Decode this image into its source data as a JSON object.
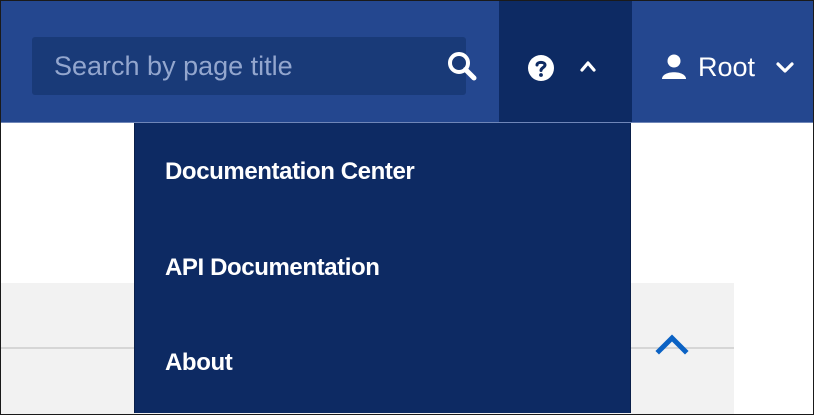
{
  "header": {
    "search": {
      "placeholder": "Search by page title"
    },
    "user": {
      "label": "Root"
    }
  },
  "help_menu": {
    "items": [
      {
        "label": "Documentation Center"
      },
      {
        "label": "API Documentation"
      },
      {
        "label": "About"
      }
    ]
  },
  "icons": {
    "search": "search-icon",
    "help": "question-circle-icon",
    "help_toggle_state": "chevron-up-icon",
    "user": "user-icon",
    "user_toggle_state": "chevron-down-icon",
    "collapse": "chevron-up-icon"
  },
  "colors": {
    "header_bg": "#24478f",
    "active_toggle_bg": "#0d2a63",
    "search_bg": "#193a78",
    "dropdown_bg": "#0d2a63",
    "accent_chevron": "#0b62c4"
  }
}
